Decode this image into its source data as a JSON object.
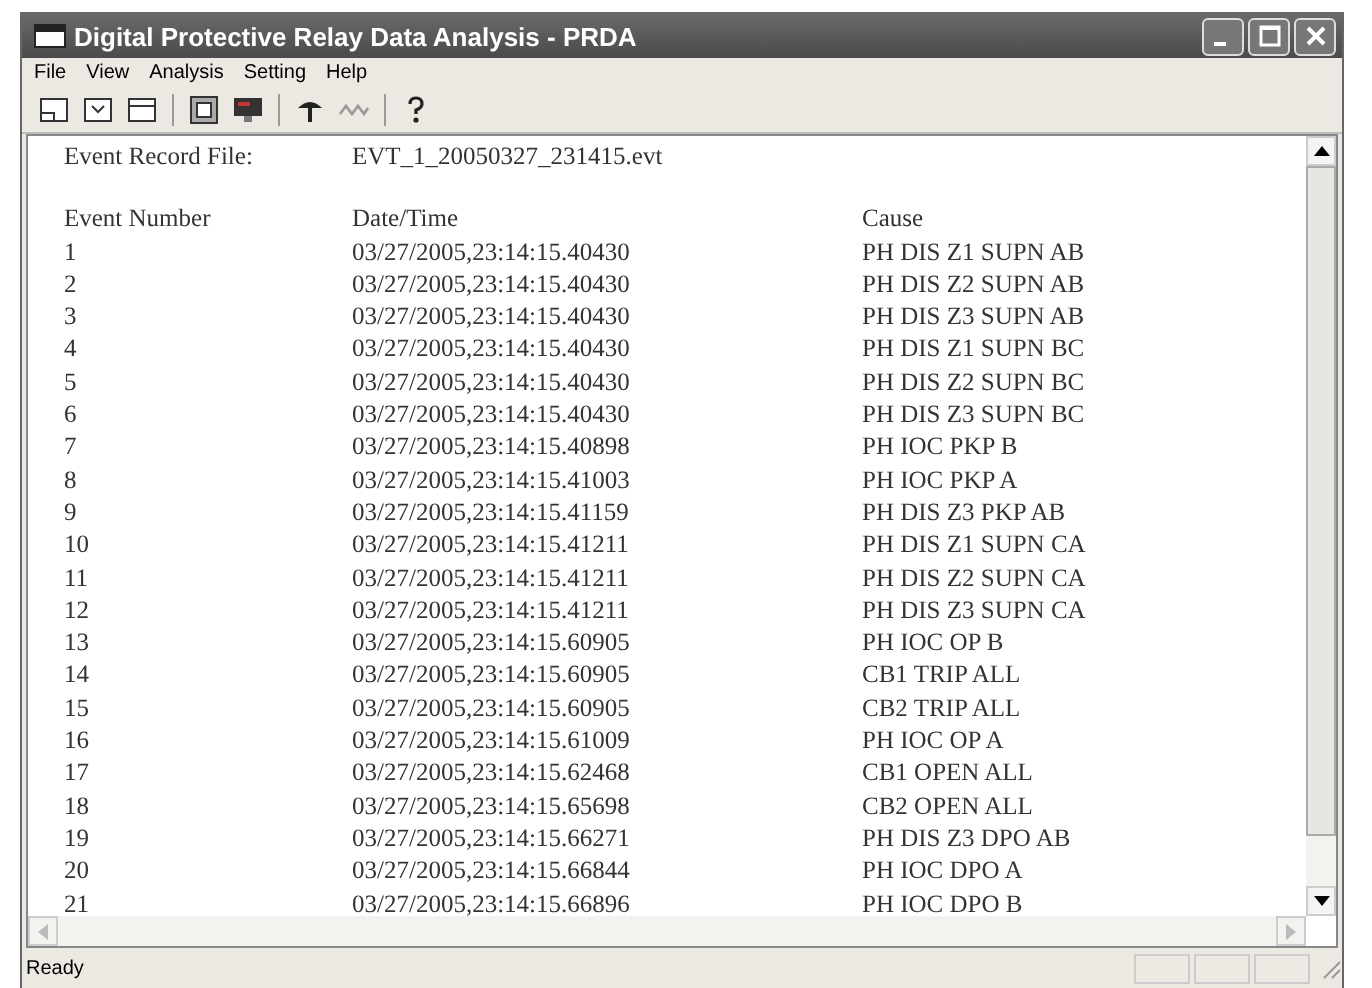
{
  "window": {
    "title": "Digital Protective Relay Data Analysis - PRDA"
  },
  "menu": [
    "File",
    "View",
    "Analysis",
    "Setting",
    "Help"
  ],
  "record_file": {
    "label": "Event Record File:",
    "value": "EVT_1_20050327_231415.evt"
  },
  "table": {
    "columns": [
      "Event Number",
      "Date/Time",
      "Cause"
    ],
    "rows": [
      [
        "1",
        "03/27/2005,23:14:15.40430",
        "PH DIS Z1 SUPN AB"
      ],
      [
        "2",
        "03/27/2005,23:14:15.40430",
        "PH DIS Z2 SUPN AB"
      ],
      [
        "3",
        "03/27/2005,23:14:15.40430",
        "PH DIS Z3 SUPN AB"
      ],
      [
        "4",
        "03/27/2005,23:14:15.40430",
        "PH DIS Z1 SUPN BC"
      ],
      [
        "5",
        "03/27/2005,23:14:15.40430",
        "PH DIS Z2 SUPN BC"
      ],
      [
        "6",
        "03/27/2005,23:14:15.40430",
        "PH DIS Z3 SUPN BC"
      ],
      [
        "7",
        "03/27/2005,23:14:15.40898",
        "PH IOC PKP B"
      ],
      [
        "8",
        "03/27/2005,23:14:15.41003",
        "PH IOC PKP A"
      ],
      [
        "9",
        "03/27/2005,23:14:15.41159",
        "PH DIS Z3 PKP AB"
      ],
      [
        "10",
        "03/27/2005,23:14:15.41211",
        "PH DIS Z1 SUPN CA"
      ],
      [
        "11",
        "03/27/2005,23:14:15.41211",
        "PH DIS Z2 SUPN CA"
      ],
      [
        "12",
        "03/27/2005,23:14:15.41211",
        "PH DIS Z3 SUPN CA"
      ],
      [
        "13",
        "03/27/2005,23:14:15.60905",
        "PH IOC OP B"
      ],
      [
        "14",
        "03/27/2005,23:14:15.60905",
        "CB1 TRIP ALL"
      ],
      [
        "15",
        "03/27/2005,23:14:15.60905",
        "CB2 TRIP ALL"
      ],
      [
        "16",
        "03/27/2005,23:14:15.61009",
        "PH IOC OP A"
      ],
      [
        "17",
        "03/27/2005,23:14:15.62468",
        "CB1 OPEN ALL"
      ],
      [
        "18",
        "03/27/2005,23:14:15.65698",
        "CB2 OPEN ALL"
      ],
      [
        "19",
        "03/27/2005,23:14:15.66271",
        "PH DIS Z3 DPO AB"
      ],
      [
        "20",
        "03/27/2005,23:14:15.66844",
        "PH IOC DPO A"
      ],
      [
        "21",
        "03/27/2005,23:14:15.66896",
        "PH IOC DPO B"
      ]
    ]
  },
  "status_bar": {
    "text": "Ready"
  }
}
